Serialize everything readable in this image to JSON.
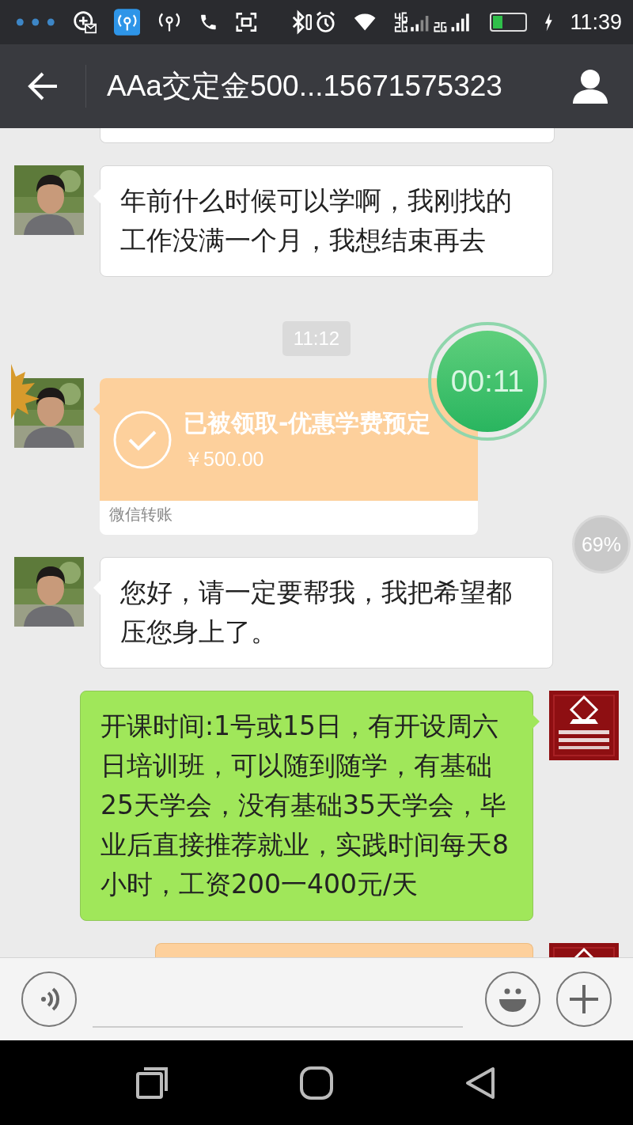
{
  "status_bar": {
    "time": "11:39",
    "battery": {
      "level": 0.3,
      "charging": true
    }
  },
  "header": {
    "title": "AAa交定金500...15671575323"
  },
  "messages": [
    {
      "kind": "tail"
    },
    {
      "kind": "received",
      "text": "年前什么时候可以学啊，我刚找的工作没满一个月，我想结束再去"
    },
    {
      "kind": "time",
      "text": "11:12"
    },
    {
      "kind": "transfer",
      "title": "已被领取-优惠学费预定",
      "amount": "￥500.00",
      "footer": "微信转账"
    },
    {
      "kind": "received",
      "text": "您好，请一定要帮我，我把希望都压您身上了。"
    },
    {
      "kind": "sent",
      "text": "开课时间:1号或15日，有开设周六日培训班，可以随到随学，有基础25天学会，没有基础35天学会，毕业后直接推荐就业，实践时间每天8小时，工资200一400元/天"
    },
    {
      "kind": "head"
    }
  ],
  "recorder_timer": {
    "text": "00:11"
  },
  "float_ball": {
    "text": "69%"
  }
}
